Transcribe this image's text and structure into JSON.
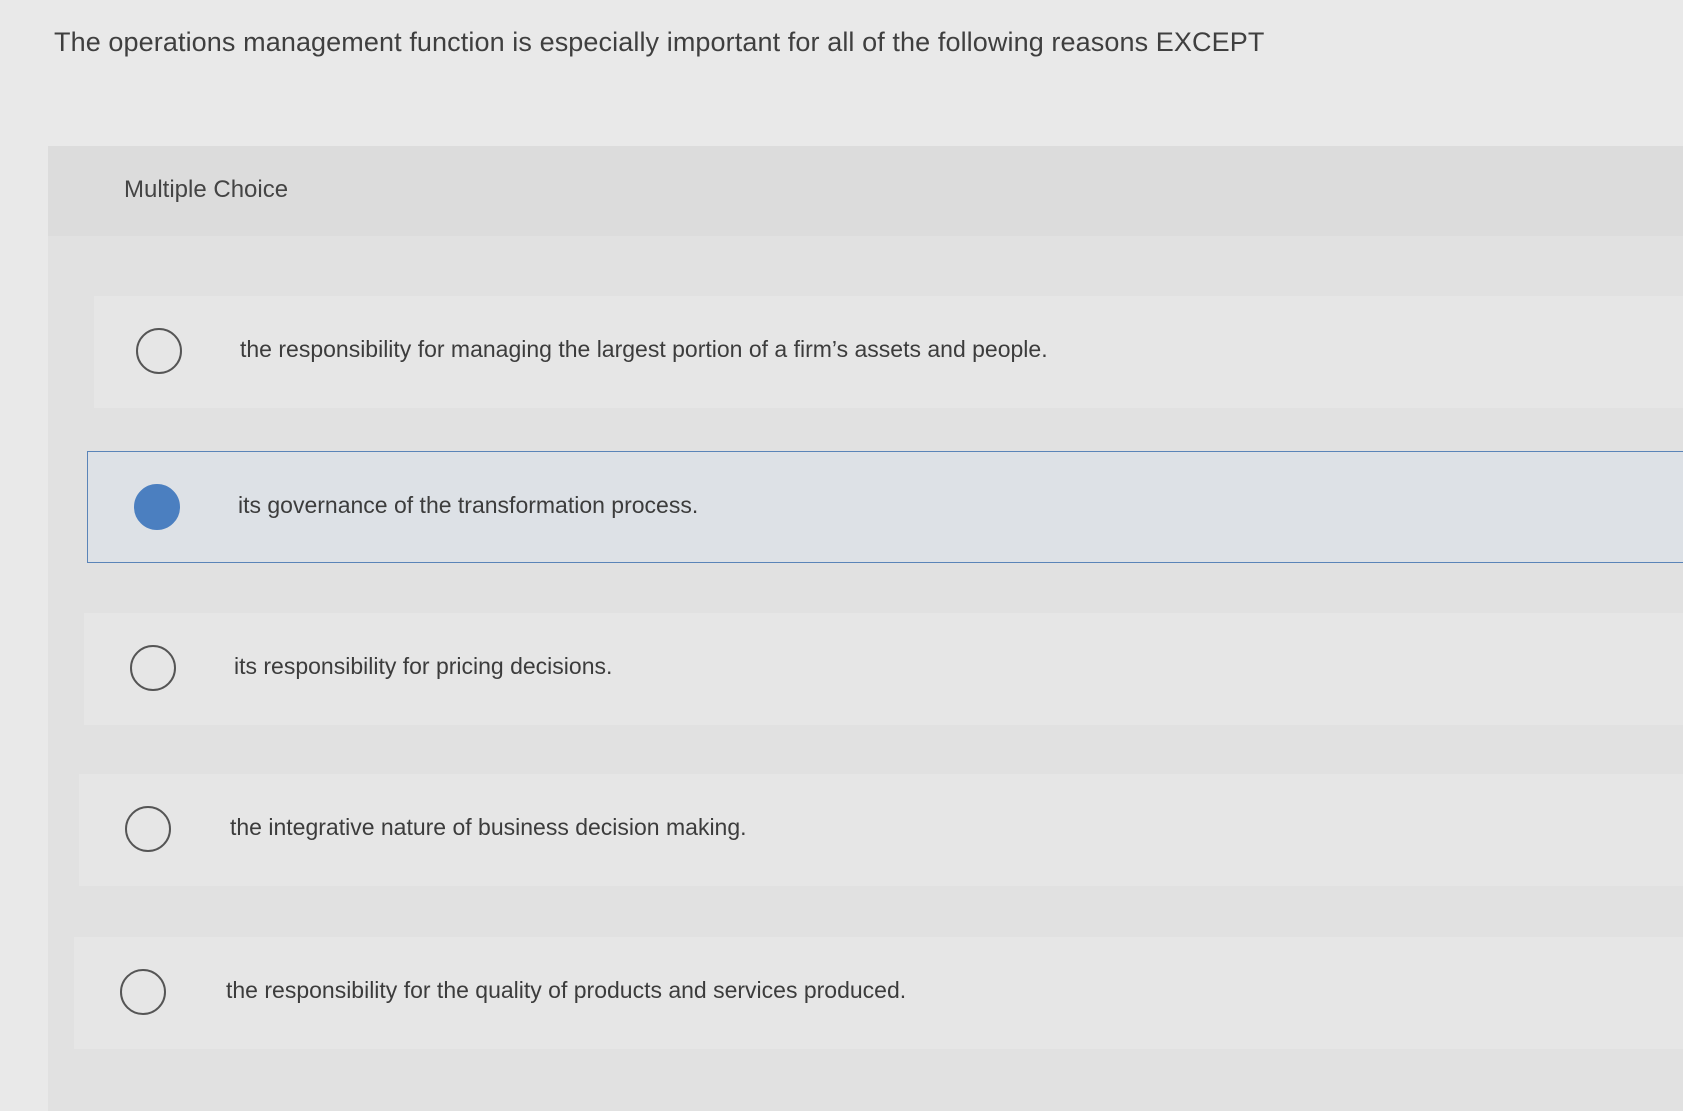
{
  "question": {
    "text": "The operations management function is especially important for all of the following reasons EXCEPT"
  },
  "panel": {
    "title": "Multiple Choice"
  },
  "choices": [
    {
      "label": "the responsibility for managing the largest portion of a firm’s assets and people.",
      "selected": false
    },
    {
      "label": "its governance of the transformation process.",
      "selected": true
    },
    {
      "label": "its responsibility for pricing decisions.",
      "selected": false
    },
    {
      "label": "the integrative nature of business decision making.",
      "selected": false
    },
    {
      "label": "the responsibility for the quality of products and services produced.",
      "selected": false
    }
  ],
  "colors": {
    "selected_radio": "#4b7fc0",
    "selected_border": "#5a84b8"
  }
}
